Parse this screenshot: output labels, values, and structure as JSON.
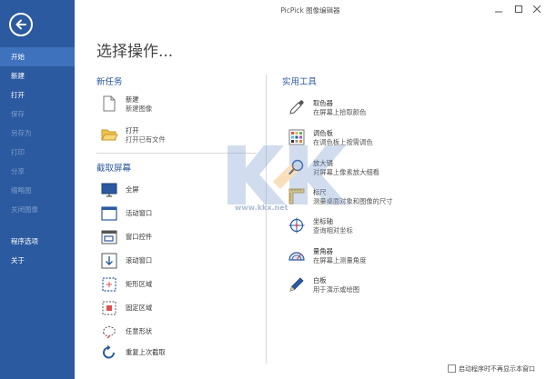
{
  "app": {
    "title": "PicPick 图像编辑器"
  },
  "sidebar": {
    "items": [
      {
        "label": "开始",
        "state": "active"
      },
      {
        "label": "新建",
        "state": "normal"
      },
      {
        "label": "打开",
        "state": "normal"
      },
      {
        "label": "保存",
        "state": "disabled"
      },
      {
        "label": "另存为",
        "state": "disabled"
      },
      {
        "label": "打印",
        "state": "disabled"
      },
      {
        "label": "分享",
        "state": "disabled"
      },
      {
        "label": "缩略图",
        "state": "disabled"
      },
      {
        "label": "关闭图像",
        "state": "disabled"
      }
    ],
    "bottom_items": [
      {
        "label": "程序选项"
      },
      {
        "label": "关于"
      }
    ]
  },
  "main": {
    "heading": "选择操作...",
    "new_task": {
      "title": "新任务",
      "items": [
        {
          "title": "新建",
          "desc": "新建图像",
          "icon": "new-file-icon"
        },
        {
          "title": "打开",
          "desc": "打开已有文件",
          "icon": "open-folder-icon"
        }
      ]
    },
    "capture": {
      "title": "截取屏幕",
      "items": [
        {
          "title": "全屏",
          "icon": "monitor-icon"
        },
        {
          "title": "活动窗口",
          "icon": "active-window-icon"
        },
        {
          "title": "窗口控件",
          "icon": "window-control-icon"
        },
        {
          "title": "滚动窗口",
          "icon": "scroll-window-icon"
        },
        {
          "title": "矩形区域",
          "icon": "rectangle-region-icon"
        },
        {
          "title": "固定区域",
          "icon": "fixed-region-icon"
        },
        {
          "title": "任意形状",
          "icon": "freehand-icon"
        },
        {
          "title": "重复上次截取",
          "icon": "repeat-icon"
        }
      ]
    },
    "tools": {
      "title": "实用工具",
      "items": [
        {
          "title": "取色器",
          "desc": "在屏幕上拾取颜色",
          "icon": "eyedropper-icon"
        },
        {
          "title": "调色板",
          "desc": "在调色板上按需调色",
          "icon": "palette-icon"
        },
        {
          "title": "放大镜",
          "desc": "对屏幕上像素放大细看",
          "icon": "magnifier-icon"
        },
        {
          "title": "标尺",
          "desc": "测量桌面对象和图像的尺寸",
          "icon": "ruler-icon"
        },
        {
          "title": "坐标轴",
          "desc": "查询相对坐标",
          "icon": "crosshair-icon"
        },
        {
          "title": "量角器",
          "desc": "在屏幕上测量角度",
          "icon": "protractor-icon"
        },
        {
          "title": "白板",
          "desc": "用于演示或绘图",
          "icon": "pen-icon"
        }
      ]
    }
  },
  "watermark": {
    "url": "www.kkx.net"
  },
  "footer": {
    "checkbox_label": "启动程序时不再显示本窗口",
    "checked": false
  },
  "colors": {
    "sidebar": "#2c5aa0",
    "active": "#3f72bd",
    "accent": "#2c5aa0"
  }
}
